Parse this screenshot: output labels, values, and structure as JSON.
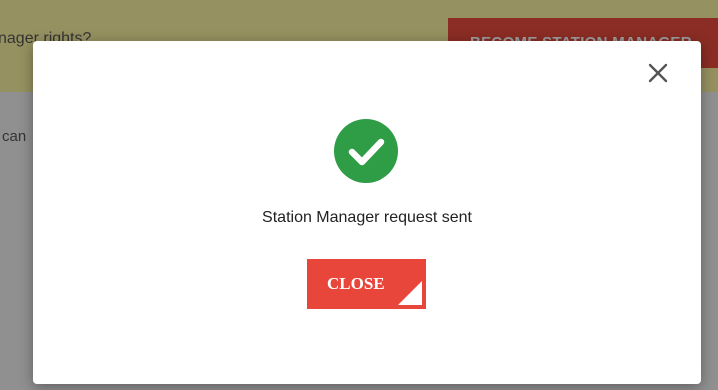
{
  "background": {
    "banner_text": "nager rights?",
    "banner_button_label": "BECOME STATION MANAGER",
    "body_text": "can"
  },
  "modal": {
    "message": "Station Manager request sent",
    "close_button_label": "CLOSE",
    "close_icon": "close-icon",
    "status_icon": "check-circle-icon"
  },
  "colors": {
    "accent_red": "#e8453b",
    "success_green": "#2f9c46",
    "banner_yellow": "#f2eb9c"
  }
}
